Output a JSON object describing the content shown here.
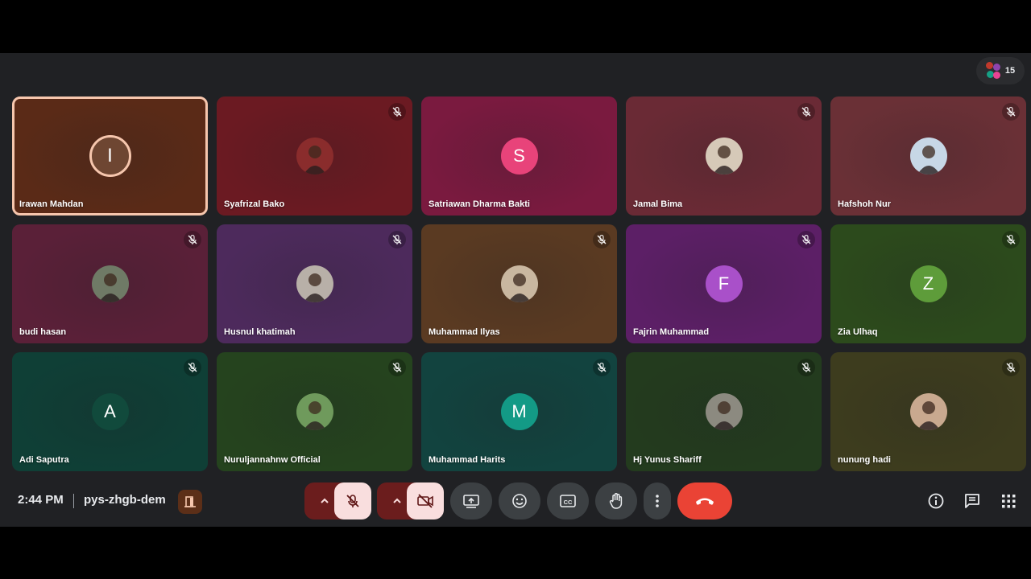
{
  "meeting": {
    "participant_count": "15",
    "time": "2:44 PM",
    "code": "pys-zhgb-dem"
  },
  "participants": [
    {
      "name": "Irawan Mahdan",
      "initial": "I",
      "muted": false,
      "speaking": true,
      "bg": "#5a2a17",
      "avatar_bg": "#6e4632"
    },
    {
      "name": "Syafrizal Bako",
      "initial": "",
      "muted": true,
      "photo": true,
      "bg": "#6b1a22",
      "avatar_bg": "#8a2c2c"
    },
    {
      "name": "Satriawan Dharma Bakti",
      "initial": "S",
      "muted": false,
      "bg": "#7a1a3f",
      "avatar_bg": "#e8437a"
    },
    {
      "name": "Jamal Bima",
      "initial": "",
      "muted": true,
      "photo": true,
      "bg": "#6a2a35",
      "avatar_bg": "#d6c9b8"
    },
    {
      "name": "Hafshoh Nur",
      "initial": "",
      "muted": true,
      "photo": true,
      "bg": "#6a3036",
      "avatar_bg": "#c7d7e6"
    },
    {
      "name": "budi hasan",
      "initial": "",
      "muted": true,
      "photo": true,
      "bg": "#5a2038",
      "avatar_bg": "#6f7a66"
    },
    {
      "name": "Husnul khatimah",
      "initial": "",
      "muted": true,
      "photo": true,
      "bg": "#4d2a5c",
      "avatar_bg": "#b8b0a8"
    },
    {
      "name": "Muhammad Ilyas",
      "initial": "",
      "muted": true,
      "photo": true,
      "bg": "#5a3a22",
      "avatar_bg": "#c9b7a0"
    },
    {
      "name": "Fajrin Muhammad",
      "initial": "F",
      "muted": true,
      "bg": "#5c1f66",
      "avatar_bg": "#a950c9"
    },
    {
      "name": "Zia Ulhaq",
      "initial": "Z",
      "muted": true,
      "bg": "#2c4a1c",
      "avatar_bg": "#5e9c3a"
    },
    {
      "name": "Adi Saputra",
      "initial": "A",
      "muted": true,
      "bg": "#0f3f36",
      "avatar_bg": "#114a3c"
    },
    {
      "name": "Nuruljannahnw Official",
      "initial": "",
      "muted": true,
      "photo": true,
      "bg": "#25431e",
      "avatar_bg": "#6f9a5c"
    },
    {
      "name": "Muhammad Harits",
      "initial": "M",
      "muted": true,
      "bg": "#12433f",
      "avatar_bg": "#139a86"
    },
    {
      "name": "Hj Yunus Shariff",
      "initial": "",
      "muted": true,
      "photo": true,
      "bg": "#233b1e",
      "avatar_bg": "#8c8a80"
    },
    {
      "name": "nunung hadi",
      "initial": "",
      "muted": true,
      "photo": true,
      "bg": "#3d3c1e",
      "avatar_bg": "#c9a98f"
    }
  ],
  "controls": {
    "icons": [
      "chevron-up-icon",
      "mic-off-icon",
      "chevron-up-icon",
      "camera-off-icon",
      "present-icon",
      "emoji-icon",
      "captions-icon",
      "hand-icon",
      "more-icon",
      "end-call-icon"
    ],
    "right_icons": [
      "info-icon",
      "chat-icon",
      "apps-icon"
    ]
  },
  "colors": {
    "speaking_border": "#f6c6ad",
    "end_call": "#ea4335",
    "control_bg": "#3c4043"
  }
}
